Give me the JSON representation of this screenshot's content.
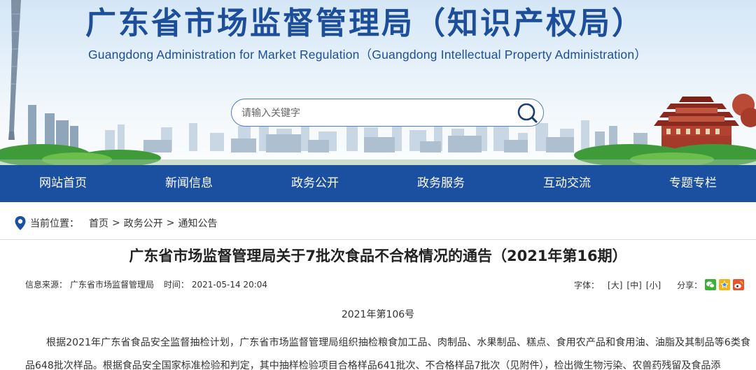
{
  "header": {
    "title_cn": "广东省市场监督管理局（知识产权局）",
    "title_en": "Guangdong Administration for Market Regulation（Guangdong Intellectual Property Administration）",
    "search": {
      "placeholder": "请输入关键字",
      "icon": "search-icon"
    }
  },
  "nav": {
    "items": [
      {
        "label": "网站首页"
      },
      {
        "label": "新闻信息"
      },
      {
        "label": "政务公开"
      },
      {
        "label": "政务服务"
      },
      {
        "label": "互动交流"
      },
      {
        "label": "专题专栏"
      }
    ],
    "color": "#1b4f9f"
  },
  "breadcrumb": {
    "label": "当前位置：",
    "items": [
      "首页",
      "政务公开",
      "通知公告"
    ],
    "separator": ">",
    "icon": "location-pin-icon"
  },
  "article": {
    "title": "广东省市场监督管理局关于7批次食品不合格情况的通告（2021年第16期）",
    "source_label": "信息来源：",
    "source": "广东省市场监督管理局",
    "time_label": "时间：",
    "time": "2021-05-14 20:04",
    "font_label": "字体：",
    "font_sizes": [
      "[大]",
      "[中]",
      "[小]"
    ],
    "share_label": "分享：",
    "share_icons": [
      "wechat-icon",
      "qzone-icon",
      "weibo-icon"
    ],
    "doc_number": "2021年第106号",
    "paragraph": "根据2021年广东省食品安全监督抽检计划，广东省市场监督管理局组织抽检粮食加工品、肉制品、水果制品、糕点、食用农产品和食用油、油脂及其制品等6类食品648批次样品。根据食品安全国家标准检验和判定，其中抽样检验项目合格样品641批次、不合格样品7批次（见附件），检出微生物污染、农兽药残留及食品添"
  }
}
